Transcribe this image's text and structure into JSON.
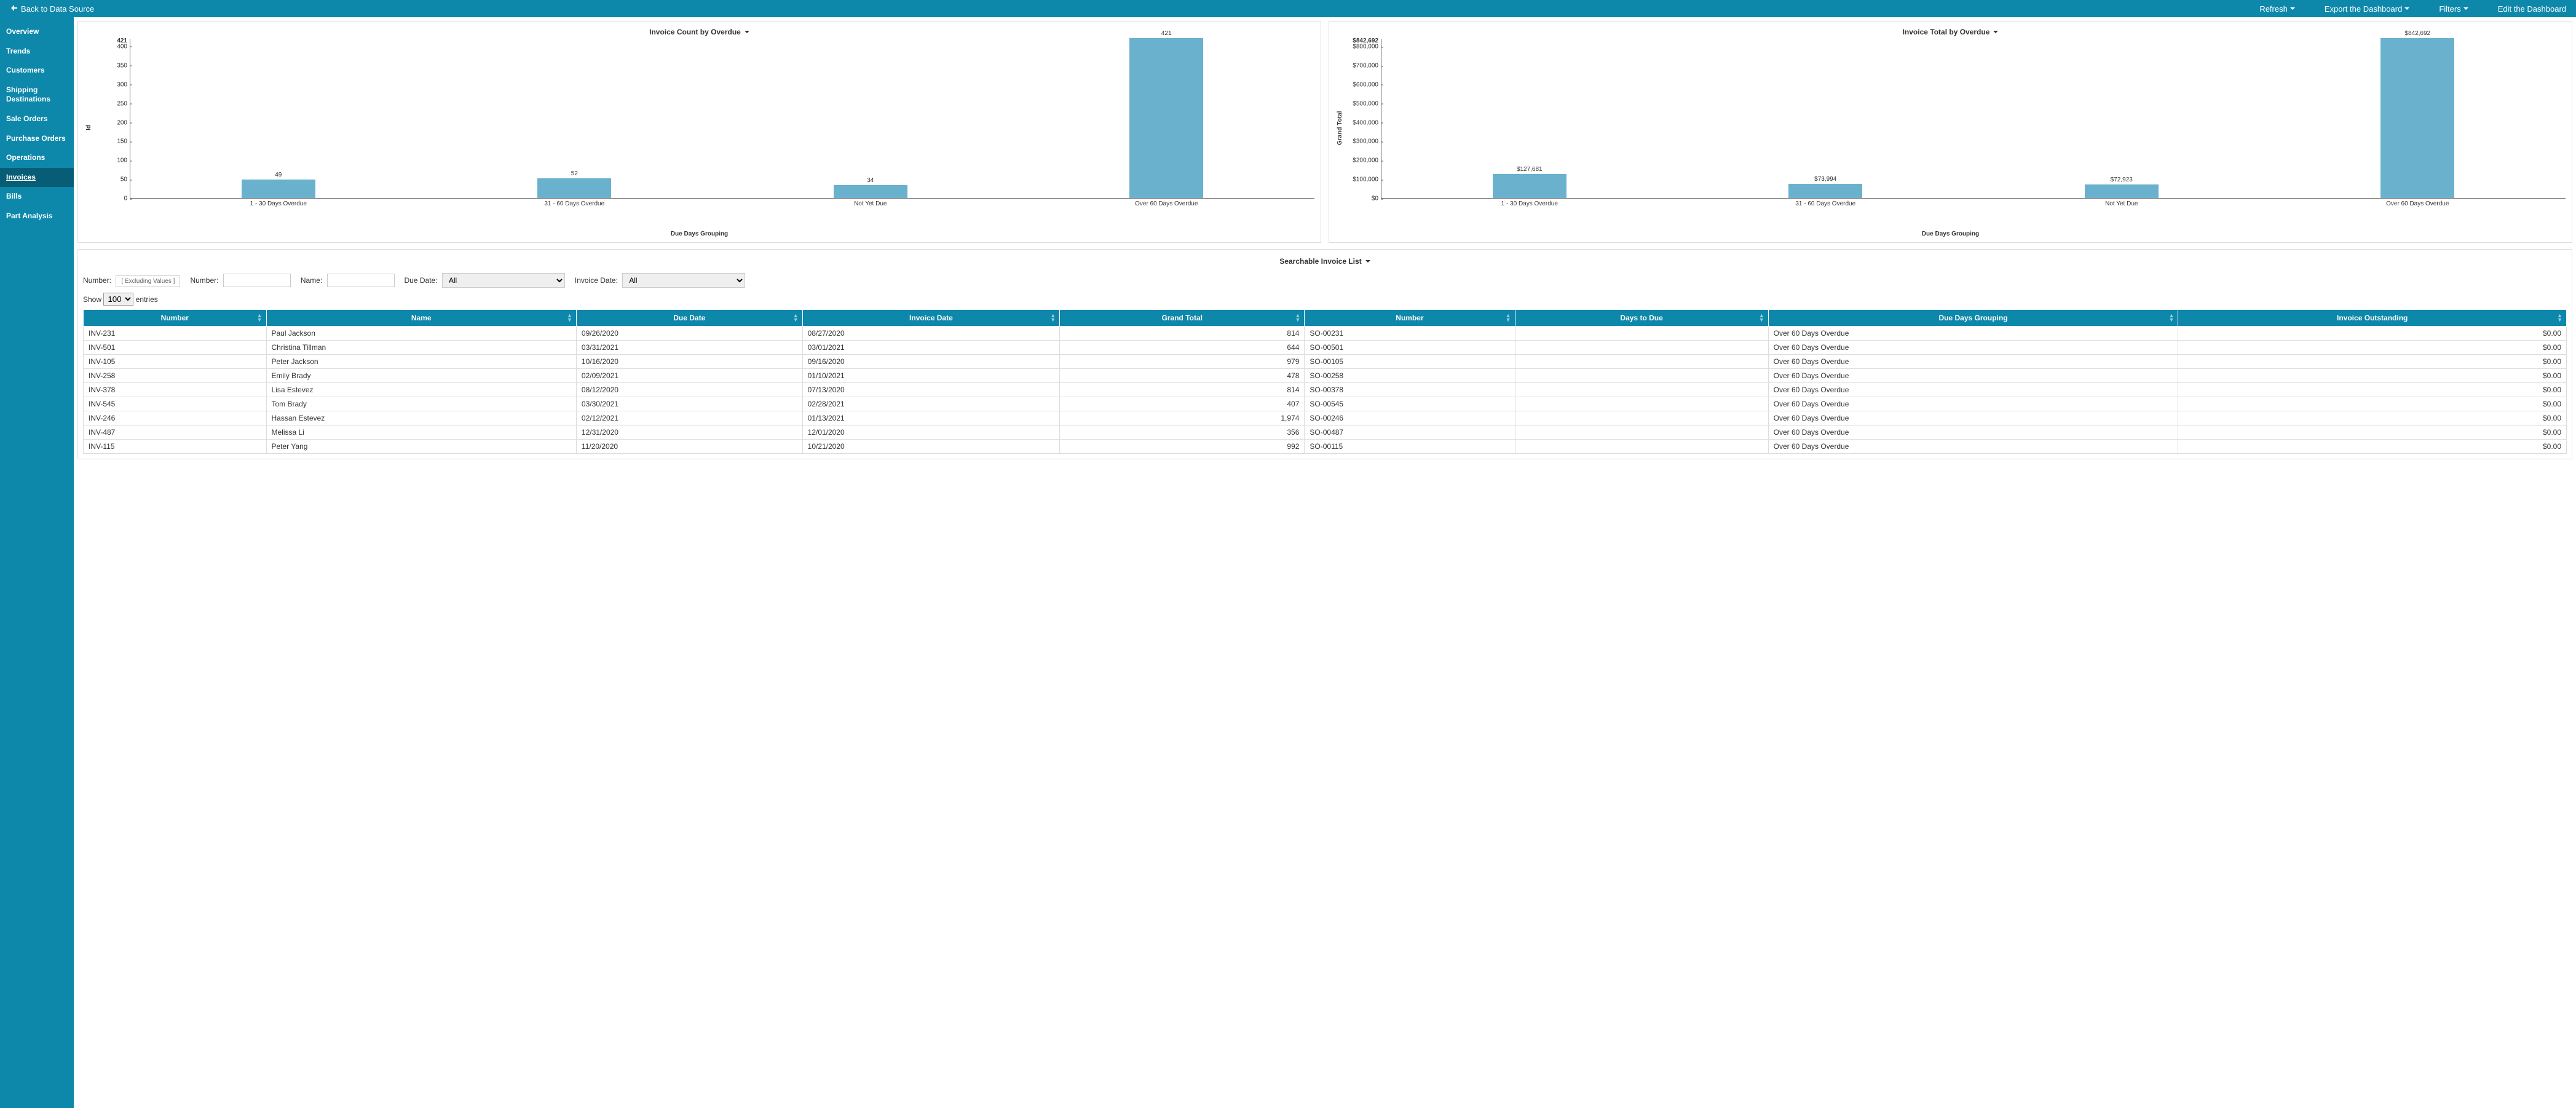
{
  "header": {
    "back_label": "Back to Data Source",
    "actions": {
      "refresh": "Refresh",
      "export": "Export the Dashboard",
      "filters": "Filters",
      "edit": "Edit the Dashboard"
    }
  },
  "sidebar": {
    "items": [
      "Overview",
      "Trends",
      "Customers",
      "Shipping Destinations",
      "Sale Orders",
      "Purchase Orders",
      "Operations",
      "Invoices",
      "Bills",
      "Part Analysis"
    ],
    "active_index": 7
  },
  "chart_data": [
    {
      "type": "bar",
      "title": "Invoice Count by Overdue",
      "xlabel": "Due Days Grouping",
      "ylabel": "Id",
      "ylim": [
        0,
        421
      ],
      "y_ticks": [
        0,
        50,
        100,
        150,
        200,
        250,
        300,
        350,
        400
      ],
      "y_max_label": "421",
      "categories": [
        "1 - 30 Days Overdue",
        "31 - 60 Days Overdue",
        "Not Yet Due",
        "Over 60 Days Overdue"
      ],
      "values": [
        49,
        52,
        34,
        421
      ],
      "value_labels": [
        "49",
        "52",
        "34",
        "421"
      ]
    },
    {
      "type": "bar",
      "title": "Invoice Total by Overdue",
      "xlabel": "Due Days Grouping",
      "ylabel": "Grand Total",
      "ylim": [
        0,
        842692
      ],
      "y_ticks": [
        0,
        100000,
        200000,
        300000,
        400000,
        500000,
        600000,
        700000,
        800000
      ],
      "y_tick_labels": [
        "$0",
        "$100,000",
        "$200,000",
        "$300,000",
        "$400,000",
        "$500,000",
        "$600,000",
        "$700,000",
        "$800,000"
      ],
      "y_max_label": "$842,692",
      "categories": [
        "1 - 30 Days Overdue",
        "31 - 60 Days Overdue",
        "Not Yet Due",
        "Over 60 Days Overdue"
      ],
      "values": [
        127681,
        73994,
        72923,
        842692
      ],
      "value_labels": [
        "$127,681",
        "$73,994",
        "$72,923",
        "$842,692"
      ]
    }
  ],
  "table_section": {
    "title": "Searchable Invoice List",
    "filters": {
      "number_label": "Number:",
      "excluding_label": "[ Excluding Values ]",
      "number2_label": "Number:",
      "name_label": "Name:",
      "due_date_label": "Due Date:",
      "due_date_value": "All",
      "invoice_date_label": "Invoice Date:",
      "invoice_date_value": "All"
    },
    "show_label_prefix": "Show",
    "show_label_suffix": "entries",
    "show_value": "100",
    "columns": [
      "Number",
      "Name",
      "Due Date",
      "Invoice Date",
      "Grand Total",
      "Number",
      "Days to Due",
      "Due Days Grouping",
      "Invoice Outstanding"
    ],
    "rows": [
      {
        "inv": "INV-231",
        "name": "Paul Jackson",
        "due": "09/26/2020",
        "invd": "08/27/2020",
        "total": "814",
        "so": "SO-00231",
        "days": "",
        "group": "Over 60 Days Overdue",
        "out": "$0.00"
      },
      {
        "inv": "INV-501",
        "name": "Christina Tillman",
        "due": "03/31/2021",
        "invd": "03/01/2021",
        "total": "644",
        "so": "SO-00501",
        "days": "",
        "group": "Over 60 Days Overdue",
        "out": "$0.00"
      },
      {
        "inv": "INV-105",
        "name": "Peter Jackson",
        "due": "10/16/2020",
        "invd": "09/16/2020",
        "total": "979",
        "so": "SO-00105",
        "days": "",
        "group": "Over 60 Days Overdue",
        "out": "$0.00"
      },
      {
        "inv": "INV-258",
        "name": "Emily Brady",
        "due": "02/09/2021",
        "invd": "01/10/2021",
        "total": "478",
        "so": "SO-00258",
        "days": "",
        "group": "Over 60 Days Overdue",
        "out": "$0.00"
      },
      {
        "inv": "INV-378",
        "name": "Lisa Estevez",
        "due": "08/12/2020",
        "invd": "07/13/2020",
        "total": "814",
        "so": "SO-00378",
        "days": "",
        "group": "Over 60 Days Overdue",
        "out": "$0.00"
      },
      {
        "inv": "INV-545",
        "name": "Tom Brady",
        "due": "03/30/2021",
        "invd": "02/28/2021",
        "total": "407",
        "so": "SO-00545",
        "days": "",
        "group": "Over 60 Days Overdue",
        "out": "$0.00"
      },
      {
        "inv": "INV-246",
        "name": "Hassan Estevez",
        "due": "02/12/2021",
        "invd": "01/13/2021",
        "total": "1,974",
        "so": "SO-00246",
        "days": "",
        "group": "Over 60 Days Overdue",
        "out": "$0.00"
      },
      {
        "inv": "INV-487",
        "name": "Melissa Li",
        "due": "12/31/2020",
        "invd": "12/01/2020",
        "total": "356",
        "so": "SO-00487",
        "days": "",
        "group": "Over 60 Days Overdue",
        "out": "$0.00"
      },
      {
        "inv": "INV-115",
        "name": "Peter Yang",
        "due": "11/20/2020",
        "invd": "10/21/2020",
        "total": "992",
        "so": "SO-00115",
        "days": "",
        "group": "Over 60 Days Overdue",
        "out": "$0.00"
      }
    ]
  }
}
